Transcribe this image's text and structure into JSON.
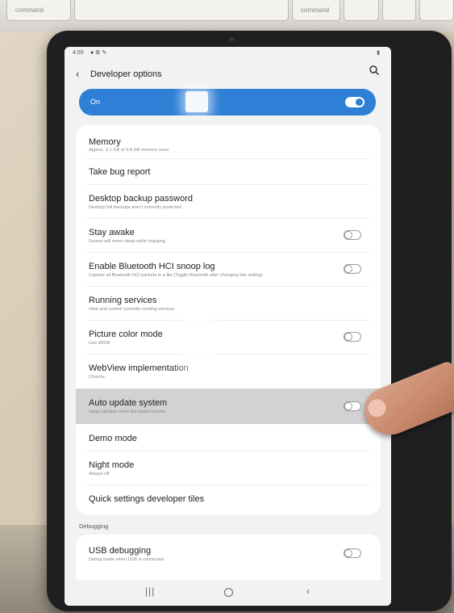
{
  "keyboard": {
    "left_key": "command",
    "right_key": "command"
  },
  "status": {
    "time": "4:59",
    "icons": "● ⚙ ✎",
    "battery": "▮"
  },
  "topbar": {
    "back": "‹",
    "title": "Developer options"
  },
  "master": {
    "label": "On",
    "on": true
  },
  "items": [
    {
      "title": "Memory",
      "subtitle": "Approx. 2.1 GB of 3.8 GB memory used"
    },
    {
      "title": "Take bug report",
      "subtitle": ""
    },
    {
      "title": "Desktop backup password",
      "subtitle": "Desktop full backups aren't currently protected"
    },
    {
      "title": "Stay awake",
      "subtitle": "Screen will never sleep while charging",
      "toggle": false
    },
    {
      "title": "Enable Bluetooth HCI snoop log",
      "subtitle": "Capture all Bluetooth HCI packets in a file (Toggle Bluetooth after changing this setting)",
      "toggle": false
    },
    {
      "title": "Running services",
      "subtitle": "View and control currently running services"
    },
    {
      "title": "Picture color mode",
      "subtitle": "Use sRGB",
      "toggle": false
    },
    {
      "title": "WebView implementation",
      "subtitle": "Chrome"
    },
    {
      "title": "Auto update system",
      "subtitle": "Apply updates when the tablet restarts.",
      "toggle": false
    },
    {
      "title": "Demo mode",
      "subtitle": ""
    },
    {
      "title": "Night mode",
      "subtitle": "Always off"
    },
    {
      "title": "Quick settings developer tiles",
      "subtitle": ""
    }
  ],
  "debugging": {
    "section": "Debugging",
    "usb_title": "USB debugging",
    "usb_sub": "Debug mode when USB is connected",
    "usb_toggle": false
  },
  "nav": {
    "recent": "|||",
    "back": "‹"
  }
}
